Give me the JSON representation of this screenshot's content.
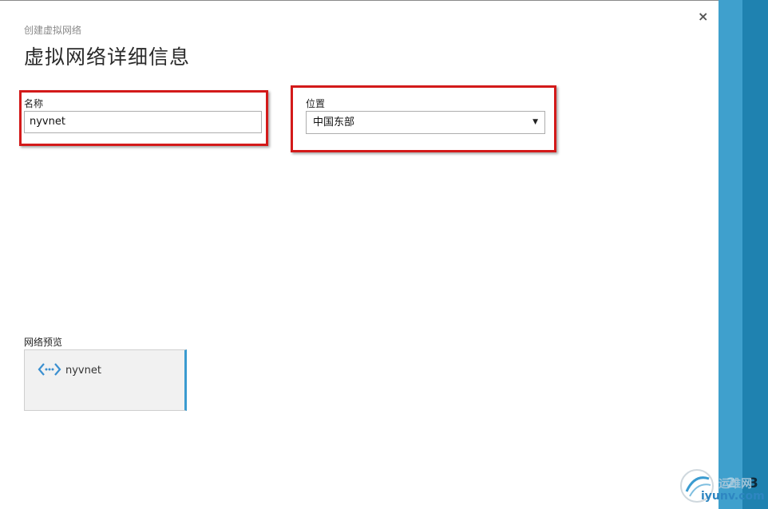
{
  "breadcrumb": "创建虚拟网络",
  "title": "虚拟网络详细信息",
  "close_glyph": "×",
  "name": {
    "label": "名称",
    "value": "nyvnet"
  },
  "location": {
    "label": "位置",
    "selected": "中国东部",
    "arrow": "▼"
  },
  "preview": {
    "label": "网络预览",
    "network_name": "nyvnet",
    "icon": "virtual-network-icon"
  },
  "steps": {
    "step2": "2",
    "step3": "3"
  },
  "watermark": {
    "line1": "运维网",
    "line2": "iyunv.com"
  },
  "colors": {
    "accent": "#3fa0cd",
    "accent_dark": "#1f82b0",
    "highlight": "#d31a1a"
  }
}
